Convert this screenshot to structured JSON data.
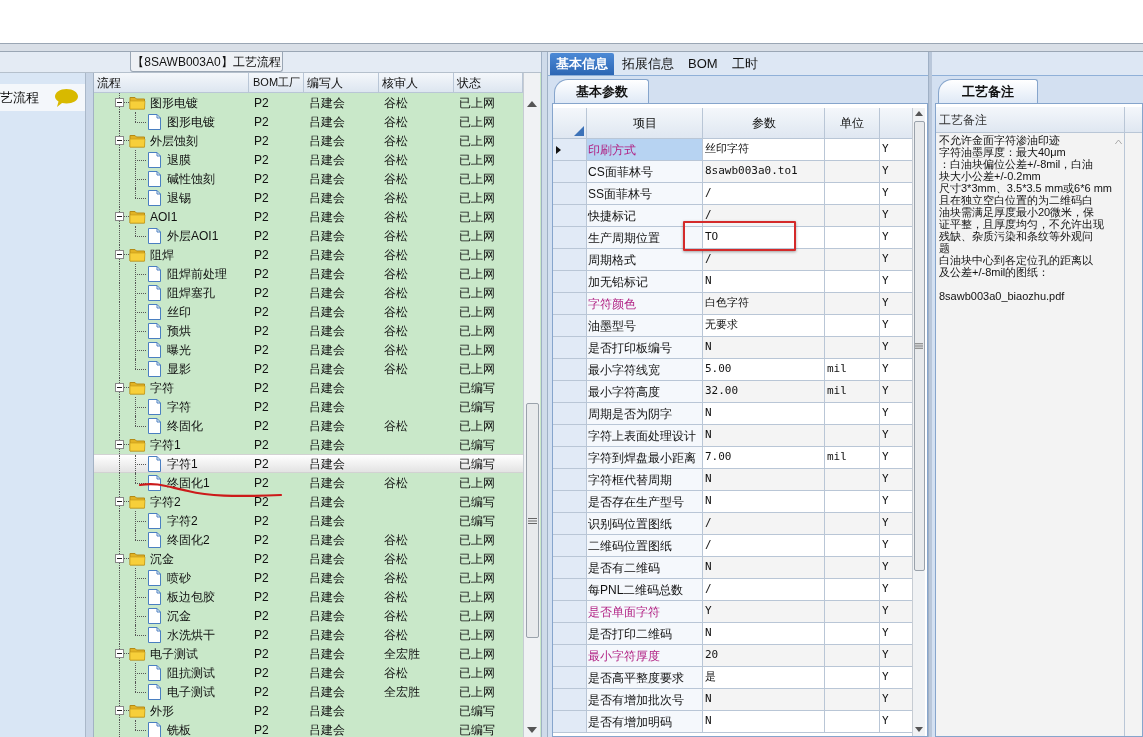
{
  "flow_panel": {
    "title": "【8SAWB003A0】工艺流程"
  },
  "sidebar": {
    "items": [
      {
        "label": "艺流程"
      }
    ]
  },
  "flow_tree": {
    "columns": [
      "流程",
      "BOM工厂",
      "编写人",
      "核审人",
      "状态"
    ],
    "nodes": [
      {
        "name": "图形电镀",
        "factory": "P2",
        "author": "吕建会",
        "reviewer": "谷松",
        "status": "已上网",
        "expanded": true,
        "selected": false,
        "children": [
          {
            "name": "图形电镀",
            "factory": "P2",
            "author": "吕建会",
            "reviewer": "谷松",
            "status": "已上网",
            "selected": false
          }
        ]
      },
      {
        "name": "外层蚀刻",
        "factory": "P2",
        "author": "吕建会",
        "reviewer": "谷松",
        "status": "已上网",
        "expanded": true,
        "selected": false,
        "children": [
          {
            "name": "退膜",
            "factory": "P2",
            "author": "吕建会",
            "reviewer": "谷松",
            "status": "已上网",
            "selected": false
          },
          {
            "name": "碱性蚀刻",
            "factory": "P2",
            "author": "吕建会",
            "reviewer": "谷松",
            "status": "已上网",
            "selected": false
          },
          {
            "name": "退锡",
            "factory": "P2",
            "author": "吕建会",
            "reviewer": "谷松",
            "status": "已上网",
            "selected": false
          }
        ]
      },
      {
        "name": "AOI1",
        "factory": "P2",
        "author": "吕建会",
        "reviewer": "谷松",
        "status": "已上网",
        "expanded": true,
        "selected": false,
        "children": [
          {
            "name": "外层AOI1",
            "factory": "P2",
            "author": "吕建会",
            "reviewer": "谷松",
            "status": "已上网",
            "selected": false
          }
        ]
      },
      {
        "name": "阻焊",
        "factory": "P2",
        "author": "吕建会",
        "reviewer": "谷松",
        "status": "已上网",
        "expanded": true,
        "selected": false,
        "children": [
          {
            "name": "阻焊前处理",
            "factory": "P2",
            "author": "吕建会",
            "reviewer": "谷松",
            "status": "已上网",
            "selected": false
          },
          {
            "name": "阻焊塞孔",
            "factory": "P2",
            "author": "吕建会",
            "reviewer": "谷松",
            "status": "已上网",
            "selected": false
          },
          {
            "name": "丝印",
            "factory": "P2",
            "author": "吕建会",
            "reviewer": "谷松",
            "status": "已上网",
            "selected": false
          },
          {
            "name": "预烘",
            "factory": "P2",
            "author": "吕建会",
            "reviewer": "谷松",
            "status": "已上网",
            "selected": false
          },
          {
            "name": "曝光",
            "factory": "P2",
            "author": "吕建会",
            "reviewer": "谷松",
            "status": "已上网",
            "selected": false
          },
          {
            "name": "显影",
            "factory": "P2",
            "author": "吕建会",
            "reviewer": "谷松",
            "status": "已上网",
            "selected": false
          }
        ]
      },
      {
        "name": "字符",
        "factory": "P2",
        "author": "吕建会",
        "status": "已编写",
        "expanded": true,
        "selected": false,
        "children": [
          {
            "name": "字符",
            "factory": "P2",
            "author": "吕建会",
            "status": "已编写",
            "selected": false
          },
          {
            "name": "终固化",
            "factory": "P2",
            "author": "吕建会",
            "reviewer": "谷松",
            "status": "已上网",
            "selected": false
          }
        ]
      },
      {
        "name": "字符1",
        "factory": "P2",
        "author": "吕建会",
        "status": "已编写",
        "expanded": true,
        "selected": false,
        "children": [
          {
            "name": "字符1",
            "factory": "P2",
            "author": "吕建会",
            "status": "已编写",
            "selected": true
          },
          {
            "name": "终固化1",
            "factory": "P2",
            "author": "吕建会",
            "reviewer": "谷松",
            "status": "已上网",
            "selected": false
          }
        ]
      },
      {
        "name": "字符2",
        "factory": "P2",
        "author": "吕建会",
        "status": "已编写",
        "expanded": true,
        "selected": false,
        "children": [
          {
            "name": "字符2",
            "factory": "P2",
            "author": "吕建会",
            "status": "已编写",
            "selected": false
          },
          {
            "name": "终固化2",
            "factory": "P2",
            "author": "吕建会",
            "reviewer": "谷松",
            "status": "已上网",
            "selected": false
          }
        ]
      },
      {
        "name": "沉金",
        "factory": "P2",
        "author": "吕建会",
        "reviewer": "谷松",
        "status": "已上网",
        "expanded": true,
        "selected": false,
        "children": [
          {
            "name": "喷砂",
            "factory": "P2",
            "author": "吕建会",
            "reviewer": "谷松",
            "status": "已上网",
            "selected": false
          },
          {
            "name": "板边包胶",
            "factory": "P2",
            "author": "吕建会",
            "reviewer": "谷松",
            "status": "已上网",
            "selected": false
          },
          {
            "name": "沉金",
            "factory": "P2",
            "author": "吕建会",
            "reviewer": "谷松",
            "status": "已上网",
            "selected": false
          },
          {
            "name": "水洗烘干",
            "factory": "P2",
            "author": "吕建会",
            "reviewer": "谷松",
            "status": "已上网",
            "selected": false
          }
        ]
      },
      {
        "name": "电子测试",
        "factory": "P2",
        "author": "吕建会",
        "reviewer": "全宏胜",
        "status": "已上网",
        "expanded": true,
        "selected": false,
        "children": [
          {
            "name": "阻抗测试",
            "factory": "P2",
            "author": "吕建会",
            "reviewer": "谷松",
            "status": "已上网",
            "selected": false
          },
          {
            "name": "电子测试",
            "factory": "P2",
            "author": "吕建会",
            "reviewer": "全宏胜",
            "status": "已上网",
            "selected": false
          }
        ]
      },
      {
        "name": "外形",
        "factory": "P2",
        "author": "吕建会",
        "status": "已编写",
        "expanded": true,
        "selected": false,
        "children": [
          {
            "name": "铣板",
            "factory": "P2",
            "author": "吕建会",
            "status": "已编写",
            "selected": false
          }
        ]
      }
    ]
  },
  "detail_tabs": [
    {
      "label": "基本信息",
      "selected": true
    },
    {
      "label": "拓展信息",
      "selected": false
    },
    {
      "label": "BOM",
      "selected": false
    },
    {
      "label": "工时",
      "selected": false
    }
  ],
  "params": {
    "subtab": "基本参数",
    "columns": [
      "项目",
      "参数",
      "单位"
    ],
    "rows": [
      {
        "item": "印刷方式",
        "value": "丝印字符",
        "flag": "Y",
        "emphasized": true,
        "selected": true
      },
      {
        "item": "CS面菲林号",
        "value": "8sawb003a0.to1",
        "flag": "Y",
        "emphasized": false,
        "selected": false
      },
      {
        "item": "SS面菲林号",
        "value": "/",
        "flag": "Y",
        "emphasized": false,
        "selected": false
      },
      {
        "item": "快捷标记",
        "value": "/",
        "flag": "Y",
        "emphasized": false,
        "selected": false
      },
      {
        "item": "生产周期位置",
        "value": "TO",
        "flag": "Y",
        "emphasized": false,
        "selected": false
      },
      {
        "item": "周期格式",
        "value": "/",
        "flag": "Y",
        "emphasized": false,
        "selected": false
      },
      {
        "item": "加无铅标记",
        "value": "N",
        "flag": "Y",
        "emphasized": false,
        "selected": false
      },
      {
        "item": "字符颜色",
        "value": "白色字符",
        "flag": "Y",
        "emphasized": true,
        "selected": false
      },
      {
        "item": "油墨型号",
        "value": "无要求",
        "flag": "Y",
        "emphasized": false,
        "selected": false
      },
      {
        "item": "是否打印板编号",
        "value": "N",
        "flag": "Y",
        "emphasized": false,
        "selected": false
      },
      {
        "item": "最小字符线宽",
        "value": "5.00",
        "unit": "mil",
        "flag": "Y",
        "emphasized": false,
        "selected": false
      },
      {
        "item": "最小字符高度",
        "value": "32.00",
        "unit": "mil",
        "flag": "Y",
        "emphasized": false,
        "selected": false
      },
      {
        "item": "周期是否为阴字",
        "value": "N",
        "flag": "Y",
        "emphasized": false,
        "selected": false
      },
      {
        "item": "字符上表面处理设计",
        "value": "N",
        "flag": "Y",
        "emphasized": false,
        "selected": false
      },
      {
        "item": "字符到焊盘最小距离",
        "value": "7.00",
        "unit": "mil",
        "flag": "Y",
        "emphasized": false,
        "selected": false
      },
      {
        "item": "字符框代替周期",
        "value": "N",
        "flag": "Y",
        "emphasized": false,
        "selected": false
      },
      {
        "item": "是否存在生产型号",
        "value": "N",
        "flag": "Y",
        "emphasized": false,
        "selected": false
      },
      {
        "item": "识别码位置图纸",
        "value": "/",
        "flag": "Y",
        "emphasized": false,
        "selected": false
      },
      {
        "item": "二维码位置图纸",
        "value": "/",
        "flag": "Y",
        "emphasized": false,
        "selected": false
      },
      {
        "item": "是否有二维码",
        "value": "N",
        "flag": "Y",
        "emphasized": false,
        "selected": false
      },
      {
        "item": "每PNL二维码总数",
        "value": "/",
        "flag": "Y",
        "emphasized": false,
        "selected": false
      },
      {
        "item": "是否单面字符",
        "value": "Y",
        "flag": "Y",
        "emphasized": true,
        "selected": false
      },
      {
        "item": "是否打印二维码",
        "value": "N",
        "flag": "Y",
        "emphasized": false,
        "selected": false
      },
      {
        "item": "最小字符厚度",
        "value": "20",
        "flag": "Y",
        "emphasized": true,
        "selected": false
      },
      {
        "item": "是否高平整度要求",
        "value": "是",
        "flag": "Y",
        "emphasized": false,
        "selected": false
      },
      {
        "item": "是否有增加批次号",
        "value": "N",
        "flag": "Y",
        "emphasized": false,
        "selected": false
      },
      {
        "item": "是否有增加明码",
        "value": "N",
        "flag": "Y",
        "emphasized": false,
        "selected": false
      }
    ]
  },
  "remarks": {
    "subtab": "工艺备注",
    "column": "工艺备注",
    "lines": [
      "不允许金面字符渗油印迹",
      "字符油墨厚度：最大40μm",
      "：白油块偏位公差+/-8mil，白油",
      "块大小公差+/-0.2mm",
      "尺寸3*3mm、3.5*3.5 mm或6*6 mm",
      "且在独立空白位置的为二维码白",
      "油块需满足厚度最小20微米，保",
      "证平整，且厚度均匀，不允许出现",
      "残缺、杂质污染和条纹等外观问",
      "题",
      "白油块中心到各定位孔的距离以",
      "及公差+/-8mil的图纸：",
      "8sawb003a0_biaozhu.pdf"
    ]
  }
}
